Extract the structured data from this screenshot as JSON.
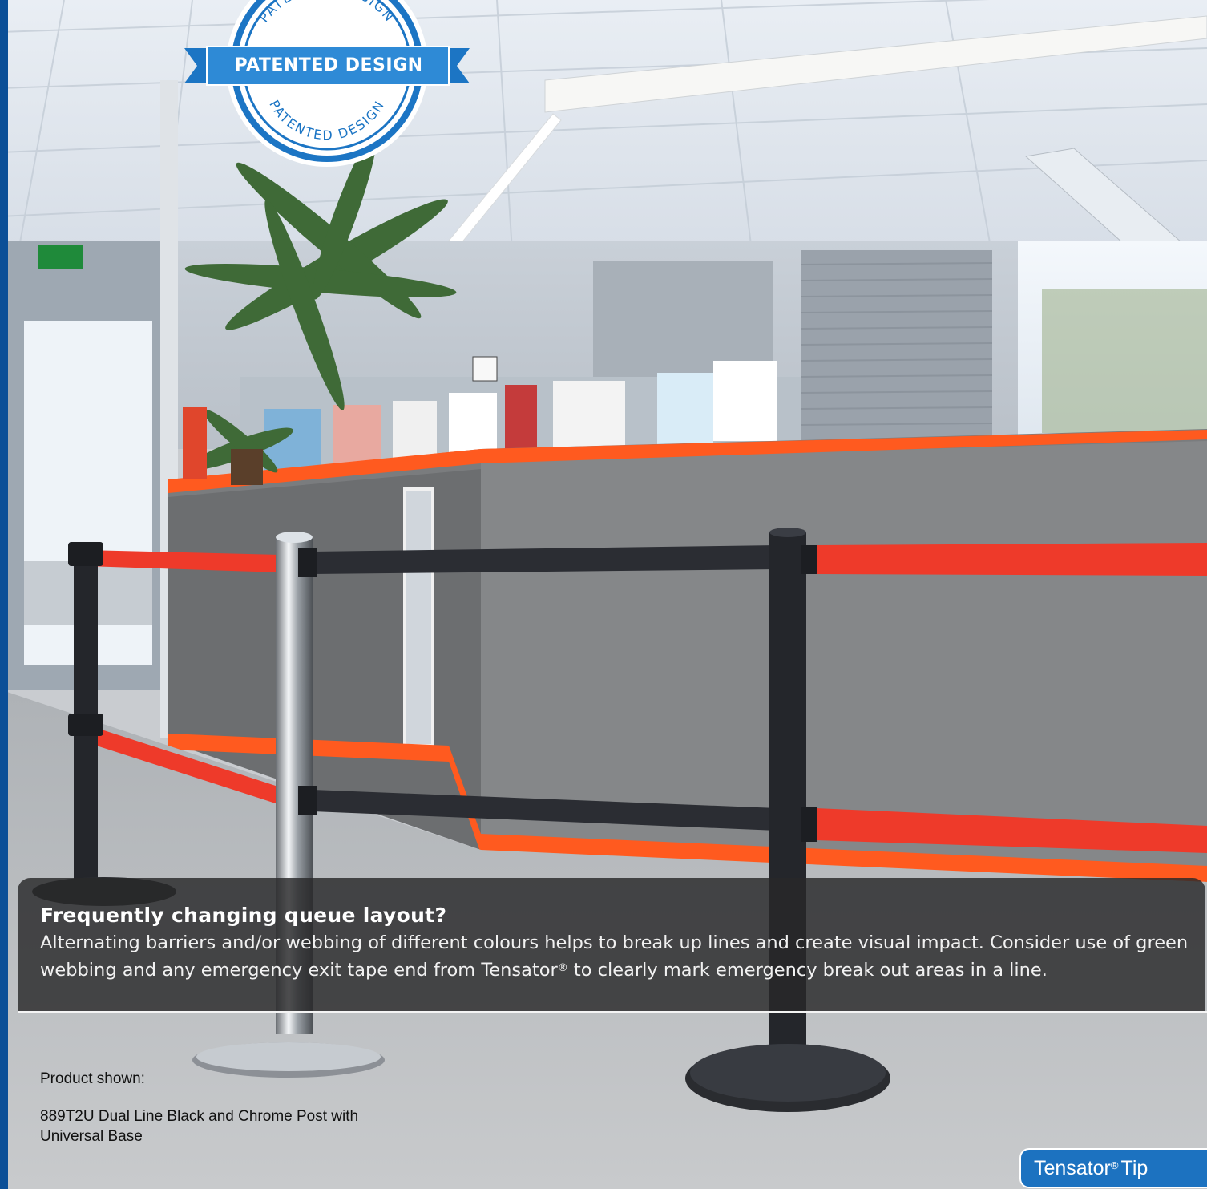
{
  "seal": {
    "banner_text": "PATENTED DESIGN",
    "ring_text": "PATENTED DESIGN",
    "color": "#1c75c4"
  },
  "tip": {
    "heading": "Frequently changing queue layout?",
    "body_before_mark": "Alternating barriers and/or webbing of different colours helps to break up lines and create visual impact. Consider use of green webbing and any emergency exit tape end from Tensator",
    "mark": "®",
    "body_after_mark": " to clearly mark emergency break out areas in a line."
  },
  "caption": {
    "label": "Product shown:",
    "product": "889T2U Dual Line Black and Chrome Post with Universal Base"
  },
  "badge": {
    "brand": "Tensator",
    "mark": "®",
    "word": "Tip",
    "color": "#1c72c0"
  },
  "scene": {
    "webbing_red": "#ee3a2a",
    "webbing_black": "#2b2d33",
    "counter_trim": "#ff5a1f"
  }
}
